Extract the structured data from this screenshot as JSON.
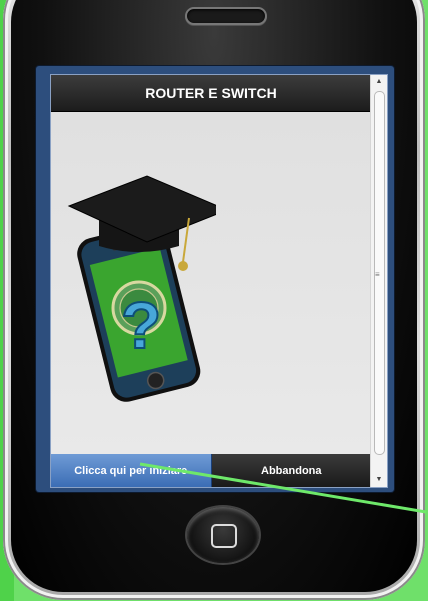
{
  "screen": {
    "title": "ROUTER E SWITCH",
    "buttons": {
      "start": "Clicca qui per iniziare",
      "quit": "Abbandona"
    }
  },
  "colors": {
    "background": "#6fe06a",
    "header": "#1c1c1c",
    "start_button": "#4a7cc2",
    "quit_button": "#222222",
    "pointer_line": "#6ee86a"
  },
  "icons": {
    "illustration": "graduation-cap-phone-question-icon",
    "scroll_up": "triangle-up-icon",
    "scroll_down": "triangle-down-icon",
    "home": "home-square-icon"
  }
}
